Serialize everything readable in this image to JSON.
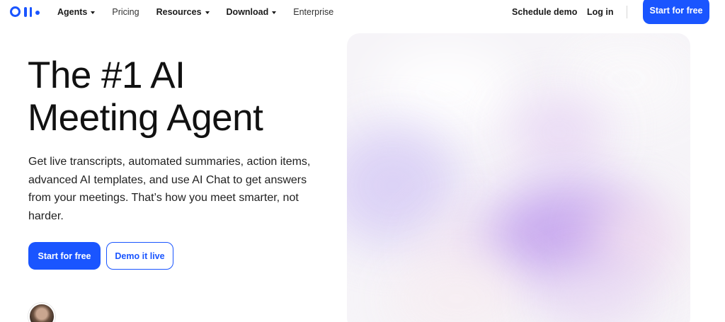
{
  "nav": {
    "logo_alt": "Otter",
    "items": [
      {
        "label": "Agents",
        "dropdown": true
      },
      {
        "label": "Pricing",
        "dropdown": false
      },
      {
        "label": "Resources",
        "dropdown": true
      },
      {
        "label": "Download",
        "dropdown": true
      },
      {
        "label": "Enterprise",
        "dropdown": false
      }
    ],
    "schedule_demo": "Schedule demo",
    "login": "Log in",
    "start_free": "Start for free"
  },
  "hero": {
    "title_line1": "The #1 AI",
    "title_line2": "Meeting Agent",
    "subtitle": "Get live transcripts, automated summaries, action items, advanced AI templates, and use AI Chat to get answers from your meetings. That’s how you meet smarter, not harder.",
    "cta_primary": "Start for free",
    "cta_secondary": "Demo it live"
  },
  "colors": {
    "brand": "#1a55ff",
    "text": "#111111"
  }
}
